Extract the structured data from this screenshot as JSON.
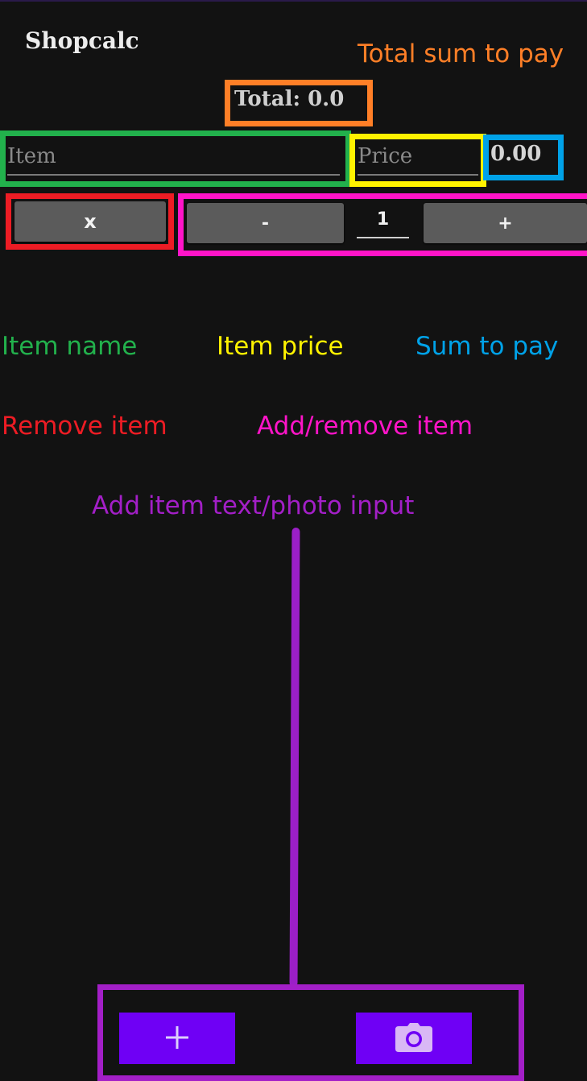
{
  "app": {
    "title": "Shopcalc",
    "total": "Total: 0.0"
  },
  "inputs": {
    "item_placeholder": "Item",
    "item_value": "",
    "price_placeholder": "Price",
    "price_value": "",
    "sum": "0.00"
  },
  "buttons": {
    "remove_label": "x",
    "minus_label": "-",
    "plus_label": "+",
    "quantity": "1"
  },
  "annotations": {
    "total_sum": "Total sum to pay",
    "item_name": "Item name",
    "item_price": "Item price",
    "sum_to_pay": "Sum to pay",
    "remove_item": "Remove item",
    "add_remove_item": "Add/remove item",
    "add_item_input": "Add item text/photo input"
  },
  "bottom_bar": {
    "add_icon": "plus-icon",
    "camera_icon": "camera-icon"
  },
  "colors": {
    "background": "#121212",
    "orange": "#ff7f27",
    "green": "#22b14c",
    "yellow": "#fff200",
    "blue": "#00a2e8",
    "red": "#ed1c24",
    "magenta": "#ff14c8",
    "purple": "#a31fc7",
    "accent": "#6f00f5",
    "button_gray": "#5b5b5b"
  }
}
